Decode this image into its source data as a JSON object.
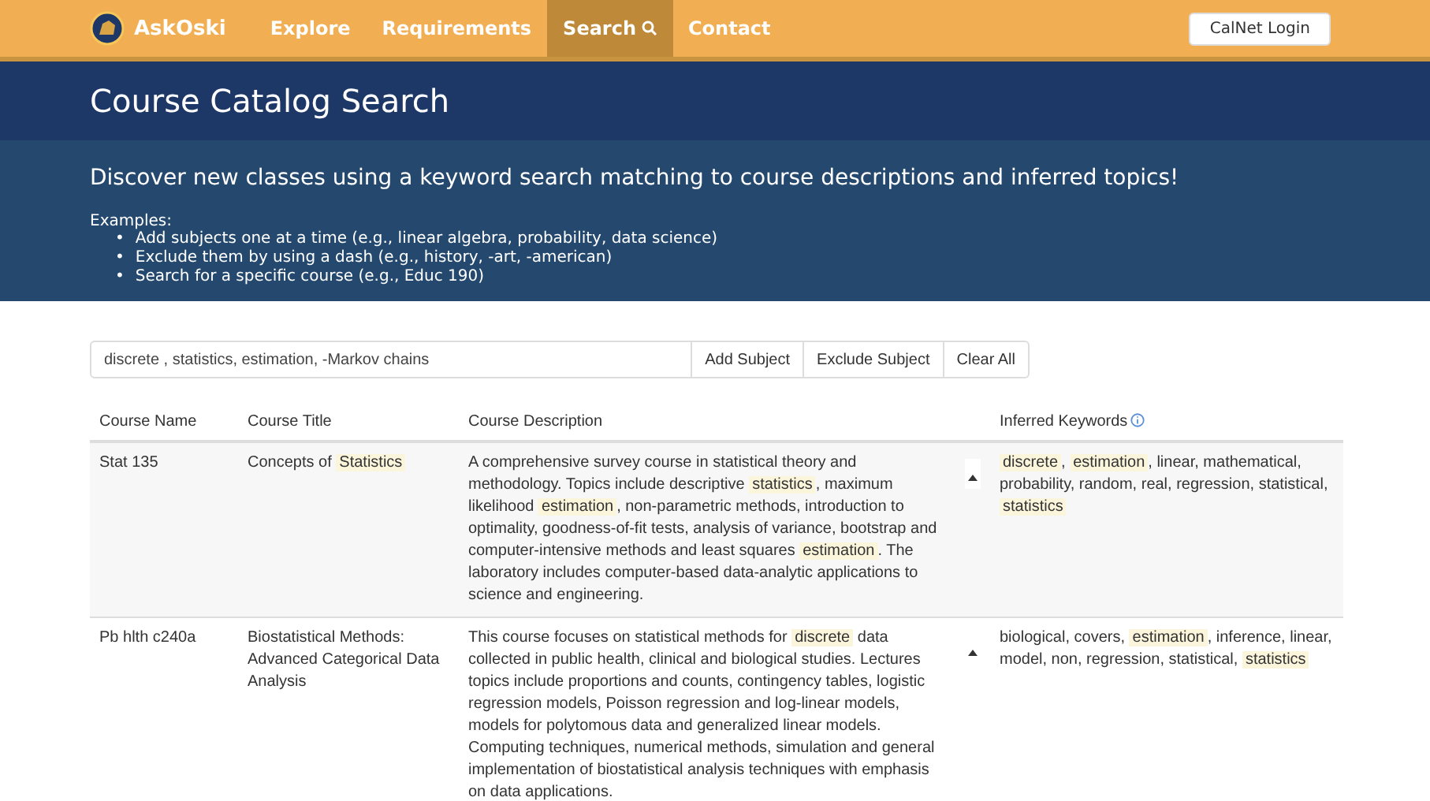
{
  "nav": {
    "brand": "AskOski",
    "items": [
      {
        "label": "Explore",
        "selected": false,
        "search_icon": false
      },
      {
        "label": "Requirements",
        "selected": false,
        "search_icon": false
      },
      {
        "label": "Search",
        "selected": true,
        "search_icon": true
      },
      {
        "label": "Contact",
        "selected": false,
        "search_icon": false
      }
    ],
    "login_button": "CalNet Login"
  },
  "page_title": "Course Catalog Search",
  "intro": {
    "headline": "Discover new classes using a keyword search matching to course descriptions and inferred topics!",
    "examples_label": "Examples:",
    "examples": [
      {
        "bullet": "•",
        "text": "Add subjects one at a time (e.g., linear algebra, probability, data science)"
      },
      {
        "bullet": "•",
        "text": "Exclude them by using a dash (e.g., history, -art, -american)"
      },
      {
        "bullet": "•",
        "text": "Search for a specific course (e.g., Educ 190)"
      }
    ]
  },
  "search": {
    "value": "discrete , statistics, estimation, -Markov chains",
    "buttons": [
      "Add Subject",
      "Exclude Subject",
      "Clear All"
    ]
  },
  "table": {
    "columns": [
      "Course Name",
      "Course Title",
      "Course Description",
      "Inferred Keywords"
    ],
    "rows": [
      {
        "name": "Stat 135",
        "title": "Concepts of **Statistics**",
        "description": "A comprehensive survey course in statistical theory and methodology. Topics include descriptive **statistics**, maximum likelihood **estimation**, non-parametric methods, introduction to optimality, goodness-of-fit tests, analysis of variance, bootstrap and computer-intensive methods and least squares **estimation**. The laboratory includes computer-based data-analytic applications to science and engineering.",
        "expanded": true,
        "keywords": "**discrete**, **estimation**, linear, mathematical, probability, random, real, regression, statistical, **statistics**"
      },
      {
        "name": "Pb hlth c240a",
        "title": "Biostatistical Methods: Advanced Categorical Data Analysis",
        "description": "This course focuses on statistical methods for **discrete** data collected in public health, clinical and biological studies. Lectures topics include proportions and counts, contingency tables, logistic regression models, Poisson regression and log-linear models, models for polytomous data and generalized linear models. Computing techniques, numerical methods, simulation and general implementation of biostatistical analysis techniques with emphasis on data applications.",
        "expanded": true,
        "keywords": "biological, covers, **estimation**, inference, linear, model, non, regression, statistical, **statistics**"
      }
    ]
  }
}
